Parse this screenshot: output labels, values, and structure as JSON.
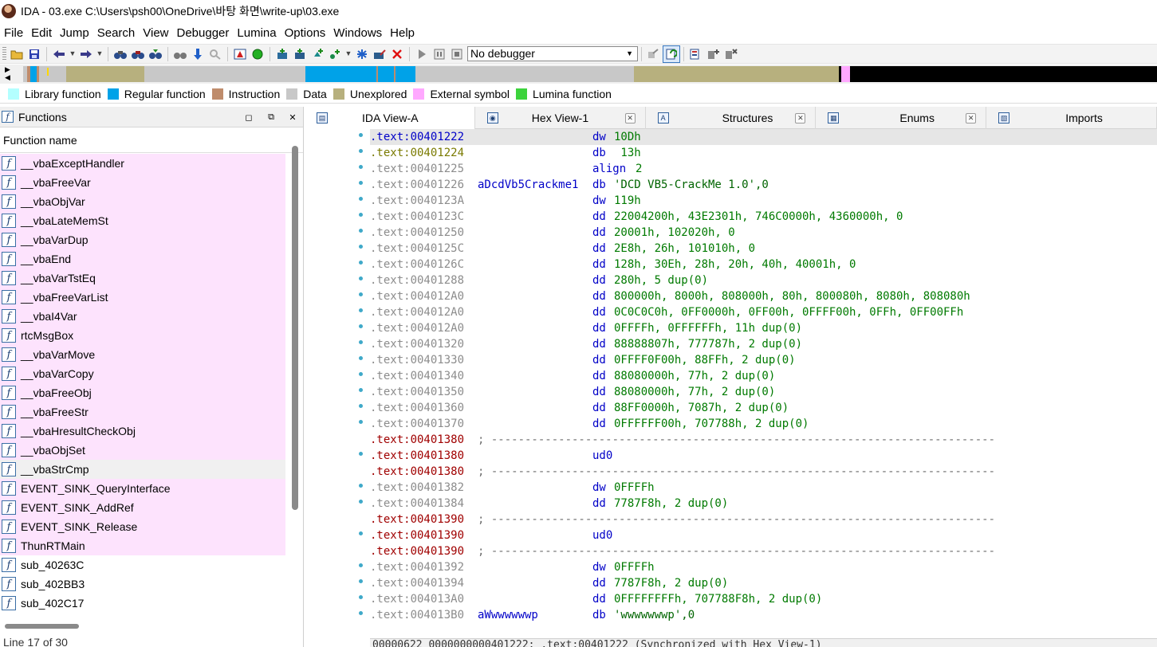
{
  "window": {
    "title": "IDA - 03.exe C:\\Users\\psh00\\OneDrive\\바탕 화면\\write-up\\03.exe"
  },
  "menu": [
    "File",
    "Edit",
    "Jump",
    "Search",
    "View",
    "Debugger",
    "Lumina",
    "Options",
    "Windows",
    "Help"
  ],
  "toolbar": {
    "debugger": "No debugger"
  },
  "legend": [
    {
      "label": "Library function",
      "color": "#b3ffff"
    },
    {
      "label": "Regular function",
      "color": "#00a2e8"
    },
    {
      "label": "Instruction",
      "color": "#bf8c6c"
    },
    {
      "label": "Data",
      "color": "#c8c8c8"
    },
    {
      "label": "Unexplored",
      "color": "#b7b07e"
    },
    {
      "label": "External symbol",
      "color": "#ffa8ff"
    },
    {
      "label": "Lumina function",
      "color": "#3cd33c"
    }
  ],
  "functions_panel": {
    "title": "Functions",
    "column": "Function name",
    "items": [
      "__vbaExceptHandler",
      "__vbaFreeVar",
      "__vbaObjVar",
      "__vbaLateMemSt",
      "__vbaVarDup",
      "__vbaEnd",
      "__vbaVarTstEq",
      "__vbaFreeVarList",
      "__vbaI4Var",
      "rtcMsgBox",
      "__vbaVarMove",
      "__vbaVarCopy",
      "__vbaFreeObj",
      "__vbaFreeStr",
      "__vbaHresultCheckObj",
      "__vbaObjSet",
      "__vbaStrCmp",
      "EVENT_SINK_QueryInterface",
      "EVENT_SINK_AddRef",
      "EVENT_SINK_Release",
      "ThunRTMain",
      "sub_40263C",
      "sub_402BB3",
      "sub_402C17"
    ],
    "status": "Line 17 of 30"
  },
  "tabs": [
    {
      "label": "IDA View-A",
      "icon": "ida-view-icon"
    },
    {
      "label": "Hex View-1",
      "icon": "hex-view-icon"
    },
    {
      "label": "Structures",
      "icon": "structures-icon"
    },
    {
      "label": "Enums",
      "icon": "enums-icon"
    },
    {
      "label": "Imports",
      "icon": "imports-icon"
    }
  ],
  "disasm": [
    {
      "addr": ".text:00401222",
      "label": "",
      "mn": "dw",
      "op": "10Dh"
    },
    {
      "addr": ".text:00401224",
      "label": "",
      "mn": "db",
      "op": " 13h"
    },
    {
      "addr": ".text:00401225",
      "label": "",
      "mn": "align",
      "op": "2"
    },
    {
      "addr": ".text:00401226",
      "label": "aDcdVb5Crackme1",
      "mn": "db",
      "op": "'DCD VB5-CrackMe 1.0',0"
    },
    {
      "addr": ".text:0040123A",
      "label": "",
      "mn": "dw",
      "op": "119h"
    },
    {
      "addr": ".text:0040123C",
      "label": "",
      "mn": "dd",
      "op": "22004200h, 43E2301h, 746C0000h, 4360000h, 0"
    },
    {
      "addr": ".text:00401250",
      "label": "",
      "mn": "dd",
      "op": "20001h, 102020h, 0"
    },
    {
      "addr": ".text:0040125C",
      "label": "",
      "mn": "dd",
      "op": "2E8h, 26h, 101010h, 0"
    },
    {
      "addr": ".text:0040126C",
      "label": "",
      "mn": "dd",
      "op": "128h, 30Eh, 28h, 20h, 40h, 40001h, 0"
    },
    {
      "addr": ".text:00401288",
      "label": "",
      "mn": "dd",
      "op": "280h, 5 dup(0)"
    },
    {
      "addr": ".text:004012A0",
      "label": "",
      "mn": "dd",
      "op": "800000h, 8000h, 808000h, 80h, 800080h, 8080h, 808080h"
    },
    {
      "addr": ".text:004012A0",
      "label": "",
      "mn": "dd",
      "op": "0C0C0C0h, 0FF0000h, 0FF00h, 0FFFF00h, 0FFh, 0FF00FFh"
    },
    {
      "addr": ".text:004012A0",
      "label": "",
      "mn": "dd",
      "op": "0FFFFh, 0FFFFFFh, 11h dup(0)"
    },
    {
      "addr": ".text:00401320",
      "label": "",
      "mn": "dd",
      "op": "88888807h, 777787h, 2 dup(0)"
    },
    {
      "addr": ".text:00401330",
      "label": "",
      "mn": "dd",
      "op": "0FFFF0F00h, 88FFh, 2 dup(0)"
    },
    {
      "addr": ".text:00401340",
      "label": "",
      "mn": "dd",
      "op": "88080000h, 77h, 2 dup(0)"
    },
    {
      "addr": ".text:00401350",
      "label": "",
      "mn": "dd",
      "op": "88080000h, 77h, 2 dup(0)"
    },
    {
      "addr": ".text:00401360",
      "label": "",
      "mn": "dd",
      "op": "88FF0000h, 7087h, 2 dup(0)"
    },
    {
      "addr": ".text:00401370",
      "label": "",
      "mn": "dd",
      "op": "0FFFFFF00h, 707788h, 2 dup(0)"
    },
    {
      "addr": ".text:00401380",
      "sep": "; ---------------------------------------------------------------------------"
    },
    {
      "addr": ".text:00401380",
      "label": "",
      "mn": "ud0",
      "op": ""
    },
    {
      "addr": ".text:00401380",
      "sep": "; ---------------------------------------------------------------------------"
    },
    {
      "addr": ".text:00401382",
      "label": "",
      "mn": "dw",
      "op": "0FFFFh"
    },
    {
      "addr": ".text:00401384",
      "label": "",
      "mn": "dd",
      "op": "7787F8h, 2 dup(0)"
    },
    {
      "addr": ".text:00401390",
      "sep": "; ---------------------------------------------------------------------------"
    },
    {
      "addr": ".text:00401390",
      "label": "",
      "mn": "ud0",
      "op": ""
    },
    {
      "addr": ".text:00401390",
      "sep": "; ---------------------------------------------------------------------------"
    },
    {
      "addr": ".text:00401392",
      "label": "",
      "mn": "dw",
      "op": "0FFFFh"
    },
    {
      "addr": ".text:00401394",
      "label": "",
      "mn": "dd",
      "op": "7787F8h, 2 dup(0)"
    },
    {
      "addr": ".text:004013A0",
      "label": "",
      "mn": "dd",
      "op": "0FFFFFFFFh, 707788F8h, 2 dup(0)"
    },
    {
      "addr": ".text:004013B0",
      "label": "aWwwwwwwp",
      "mn": "db",
      "op": "'wwwwwwwp',0"
    }
  ],
  "status_line": "00000622 0000000000401222: .text:00401222 (Synchronized with Hex View-1)"
}
